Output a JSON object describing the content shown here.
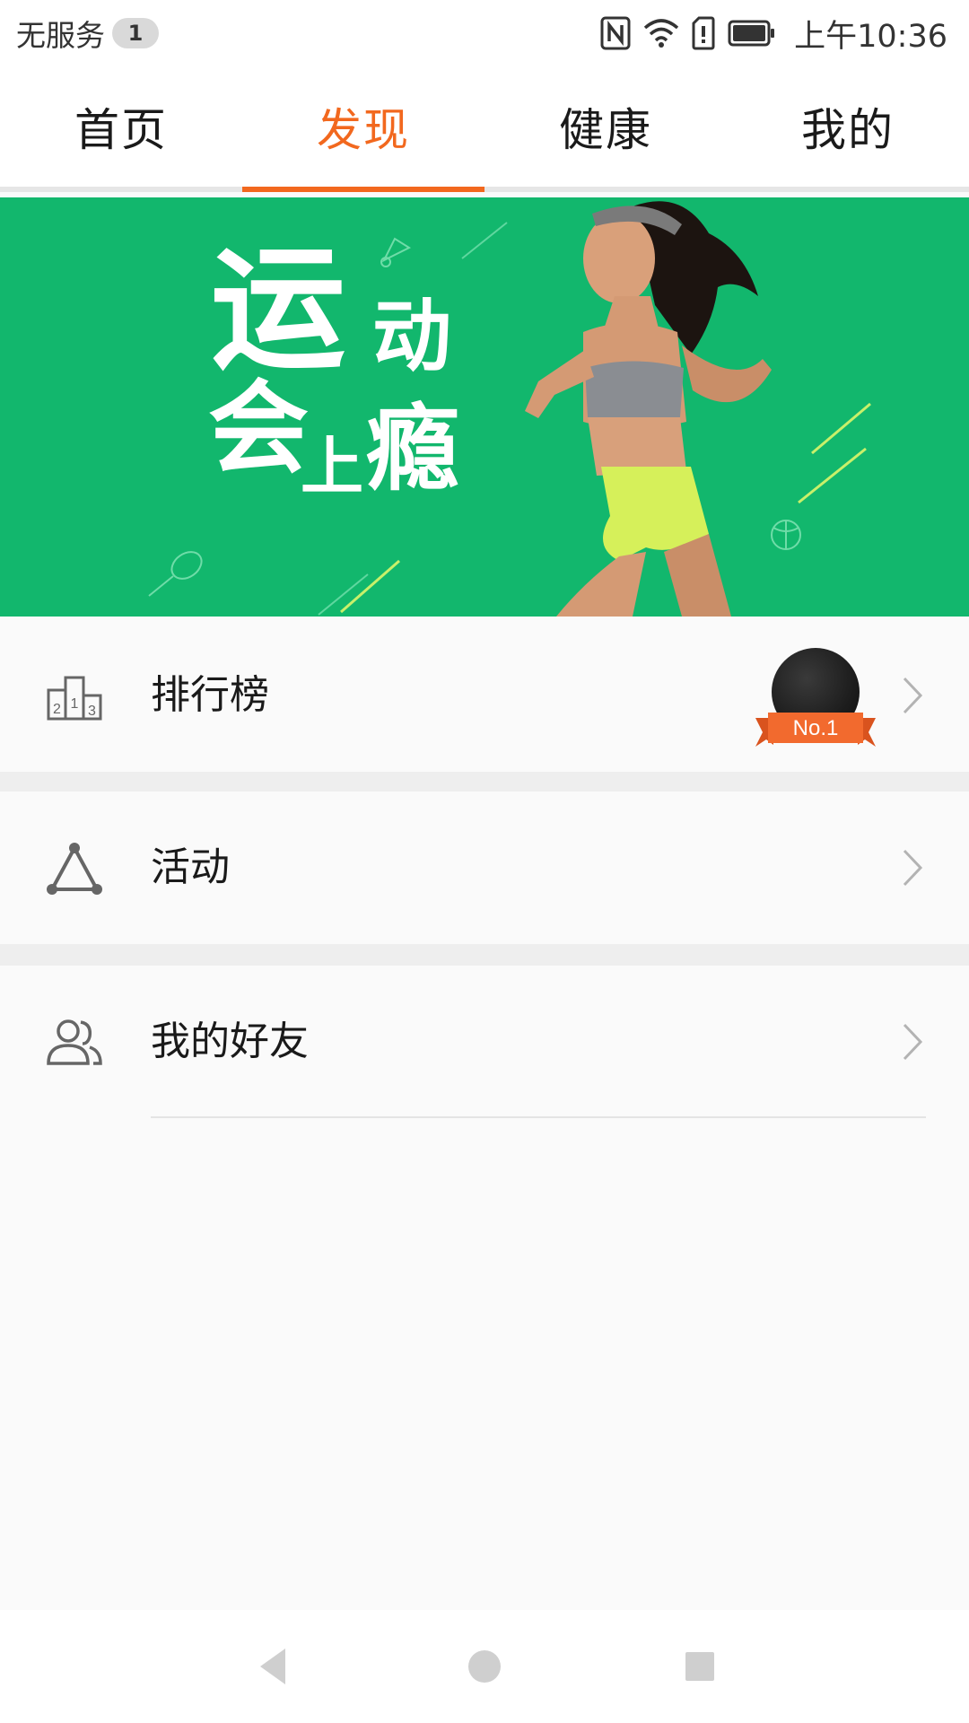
{
  "status_bar": {
    "carrier": "无服务",
    "sim_badge": "1",
    "time": "上午10:36",
    "icons": [
      "nfc-icon",
      "wifi-icon",
      "sim-alert-icon",
      "battery-icon"
    ]
  },
  "tabs": [
    {
      "label": "首页",
      "active": false
    },
    {
      "label": "发现",
      "active": true
    },
    {
      "label": "健康",
      "active": false
    },
    {
      "label": "我的",
      "active": false
    }
  ],
  "banner": {
    "slogan": [
      "运",
      "动",
      "会",
      "上",
      "瘾"
    ],
    "background": "#12b76d"
  },
  "list": [
    {
      "label": "排行榜",
      "icon": "leaderboard-icon",
      "badge": "No.1"
    },
    {
      "label": "活动",
      "icon": "activity-triangle-icon"
    },
    {
      "label": "我的好友",
      "icon": "friends-icon"
    }
  ],
  "colors": {
    "accent": "#f2681e",
    "banner_green": "#12b76d",
    "ribbon": "#f26a2e"
  },
  "nav_bar": {
    "icons": [
      "back-icon",
      "home-icon",
      "recents-icon"
    ]
  }
}
